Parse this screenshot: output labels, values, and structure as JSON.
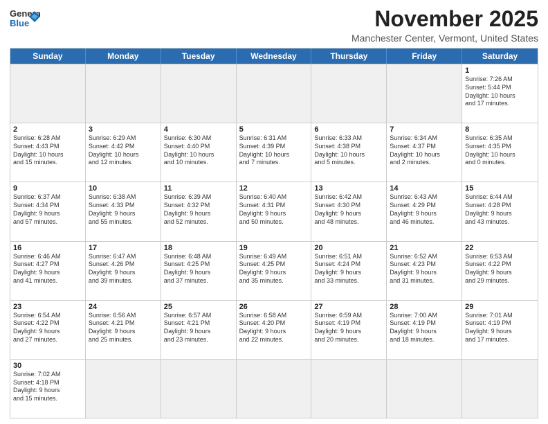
{
  "header": {
    "logo_general": "General",
    "logo_blue": "Blue",
    "month_title": "November 2025",
    "location": "Manchester Center, Vermont, United States"
  },
  "weekdays": [
    "Sunday",
    "Monday",
    "Tuesday",
    "Wednesday",
    "Thursday",
    "Friday",
    "Saturday"
  ],
  "rows": [
    [
      {
        "day": "",
        "info": ""
      },
      {
        "day": "",
        "info": ""
      },
      {
        "day": "",
        "info": ""
      },
      {
        "day": "",
        "info": ""
      },
      {
        "day": "",
        "info": ""
      },
      {
        "day": "",
        "info": ""
      },
      {
        "day": "1",
        "info": "Sunrise: 7:26 AM\nSunset: 5:44 PM\nDaylight: 10 hours\nand 17 minutes."
      }
    ],
    [
      {
        "day": "2",
        "info": "Sunrise: 6:28 AM\nSunset: 4:43 PM\nDaylight: 10 hours\nand 15 minutes."
      },
      {
        "day": "3",
        "info": "Sunrise: 6:29 AM\nSunset: 4:42 PM\nDaylight: 10 hours\nand 12 minutes."
      },
      {
        "day": "4",
        "info": "Sunrise: 6:30 AM\nSunset: 4:40 PM\nDaylight: 10 hours\nand 10 minutes."
      },
      {
        "day": "5",
        "info": "Sunrise: 6:31 AM\nSunset: 4:39 PM\nDaylight: 10 hours\nand 7 minutes."
      },
      {
        "day": "6",
        "info": "Sunrise: 6:33 AM\nSunset: 4:38 PM\nDaylight: 10 hours\nand 5 minutes."
      },
      {
        "day": "7",
        "info": "Sunrise: 6:34 AM\nSunset: 4:37 PM\nDaylight: 10 hours\nand 2 minutes."
      },
      {
        "day": "8",
        "info": "Sunrise: 6:35 AM\nSunset: 4:35 PM\nDaylight: 10 hours\nand 0 minutes."
      }
    ],
    [
      {
        "day": "9",
        "info": "Sunrise: 6:37 AM\nSunset: 4:34 PM\nDaylight: 9 hours\nand 57 minutes."
      },
      {
        "day": "10",
        "info": "Sunrise: 6:38 AM\nSunset: 4:33 PM\nDaylight: 9 hours\nand 55 minutes."
      },
      {
        "day": "11",
        "info": "Sunrise: 6:39 AM\nSunset: 4:32 PM\nDaylight: 9 hours\nand 52 minutes."
      },
      {
        "day": "12",
        "info": "Sunrise: 6:40 AM\nSunset: 4:31 PM\nDaylight: 9 hours\nand 50 minutes."
      },
      {
        "day": "13",
        "info": "Sunrise: 6:42 AM\nSunset: 4:30 PM\nDaylight: 9 hours\nand 48 minutes."
      },
      {
        "day": "14",
        "info": "Sunrise: 6:43 AM\nSunset: 4:29 PM\nDaylight: 9 hours\nand 46 minutes."
      },
      {
        "day": "15",
        "info": "Sunrise: 6:44 AM\nSunset: 4:28 PM\nDaylight: 9 hours\nand 43 minutes."
      }
    ],
    [
      {
        "day": "16",
        "info": "Sunrise: 6:46 AM\nSunset: 4:27 PM\nDaylight: 9 hours\nand 41 minutes."
      },
      {
        "day": "17",
        "info": "Sunrise: 6:47 AM\nSunset: 4:26 PM\nDaylight: 9 hours\nand 39 minutes."
      },
      {
        "day": "18",
        "info": "Sunrise: 6:48 AM\nSunset: 4:25 PM\nDaylight: 9 hours\nand 37 minutes."
      },
      {
        "day": "19",
        "info": "Sunrise: 6:49 AM\nSunset: 4:25 PM\nDaylight: 9 hours\nand 35 minutes."
      },
      {
        "day": "20",
        "info": "Sunrise: 6:51 AM\nSunset: 4:24 PM\nDaylight: 9 hours\nand 33 minutes."
      },
      {
        "day": "21",
        "info": "Sunrise: 6:52 AM\nSunset: 4:23 PM\nDaylight: 9 hours\nand 31 minutes."
      },
      {
        "day": "22",
        "info": "Sunrise: 6:53 AM\nSunset: 4:22 PM\nDaylight: 9 hours\nand 29 minutes."
      }
    ],
    [
      {
        "day": "23",
        "info": "Sunrise: 6:54 AM\nSunset: 4:22 PM\nDaylight: 9 hours\nand 27 minutes."
      },
      {
        "day": "24",
        "info": "Sunrise: 6:56 AM\nSunset: 4:21 PM\nDaylight: 9 hours\nand 25 minutes."
      },
      {
        "day": "25",
        "info": "Sunrise: 6:57 AM\nSunset: 4:21 PM\nDaylight: 9 hours\nand 23 minutes."
      },
      {
        "day": "26",
        "info": "Sunrise: 6:58 AM\nSunset: 4:20 PM\nDaylight: 9 hours\nand 22 minutes."
      },
      {
        "day": "27",
        "info": "Sunrise: 6:59 AM\nSunset: 4:19 PM\nDaylight: 9 hours\nand 20 minutes."
      },
      {
        "day": "28",
        "info": "Sunrise: 7:00 AM\nSunset: 4:19 PM\nDaylight: 9 hours\nand 18 minutes."
      },
      {
        "day": "29",
        "info": "Sunrise: 7:01 AM\nSunset: 4:19 PM\nDaylight: 9 hours\nand 17 minutes."
      }
    ],
    [
      {
        "day": "30",
        "info": "Sunrise: 7:02 AM\nSunset: 4:18 PM\nDaylight: 9 hours\nand 15 minutes."
      },
      {
        "day": "",
        "info": ""
      },
      {
        "day": "",
        "info": ""
      },
      {
        "day": "",
        "info": ""
      },
      {
        "day": "",
        "info": ""
      },
      {
        "day": "",
        "info": ""
      },
      {
        "day": "",
        "info": ""
      }
    ]
  ]
}
